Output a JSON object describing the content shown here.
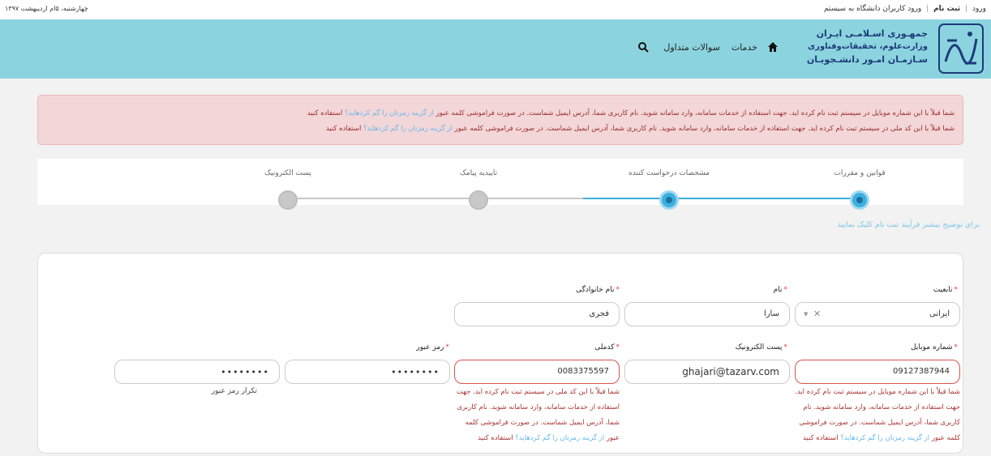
{
  "topbar": {
    "login": "ورود",
    "register": "ثبت نام",
    "welcome": "ورود کاربران دانشگاه به سیستم",
    "date": "چهارشنبه، ۵ام اردیبهشت ۱۳۹۷"
  },
  "header": {
    "org_line1": "جمهـوری اسـلامـی ایـران",
    "org_line2": "وزارت‌علوم، تحقیقات‌و‌فناوری",
    "org_line3": "سـازمـان امـور دانشـجویـان",
    "nav": {
      "services": "خدمات",
      "faq": "سوالات متداول"
    }
  },
  "alert": {
    "line1_text": "شما قبلاً با این شماره موبایل در سیستم ثبت نام کرده اید. جهت استفاده از خدمات سامانه، وارد سامانه شوید. نام کاربری شما، آدرس ایمیل شماست. در صورت فراموشی کلمه عبور ",
    "line1_link": "از گزینه رمزتان را گم کردهاید؟",
    "line1_end": " استفاده کنید",
    "line2_text": "شما قبلاً با این کد ملی در سیستم ثبت نام کرده اید. جهت استفاده از خدمات سامانه، وارد سامانه شوید. نام کاربری شما، آدرس ایمیل شماست. در صورت فراموشی کلمه عبور ",
    "line2_link": "از گزینه رمزتان را گم کردهاید؟",
    "line2_end": " استفاده کنید"
  },
  "steps": [
    {
      "label": "قوانین و مقررات",
      "active": true
    },
    {
      "label": "مشخصات درخواست کننده",
      "active": true
    },
    {
      "label": "تاییدیه پیامک",
      "active": false
    },
    {
      "label": "پست الکترونیک",
      "active": false
    }
  ],
  "explain": "برای توضیح بیشتر فرآیند ثبت نام کلیک نمایید",
  "form": {
    "nationality": {
      "label": "تابعیت",
      "value": "ایرانی"
    },
    "first_name": {
      "label": "نام",
      "value": "سارا"
    },
    "last_name": {
      "label": "نام خانوادگی",
      "value": "فجری"
    },
    "mobile": {
      "label": "شماره موبایل",
      "value": "09127387944"
    },
    "email": {
      "label": "پست الکترونیک",
      "value": "ghajari@tazarv.com"
    },
    "national_code": {
      "label": "کدملی",
      "value": "0083375597"
    },
    "password": {
      "label": "رمز عبور",
      "value": "••••••••"
    },
    "password_repeat": {
      "label": "تکرار رمز عبور",
      "value": "••••••••"
    },
    "mobile_error": {
      "text": "شما قبلاً با این شماره موبایل در سیستم ثبت نام کرده اید. جهت استفاده از خدمات سامانه، وارد سامانه شوید. نام کاربری شما، آدرس ایمیل شماست. در صورت فراموشی کلمه عبور ",
      "link": "از گزینه رمزتان را گم کردهاید؟",
      "end": " استفاده کنید"
    },
    "national_code_error": {
      "text": "شما قبلاً با این کد ملی در سیستم ثبت نام کرده اید. جهت استفاده از خدمات سامانه، وارد سامانه شوید. نام کاربری شما، آدرس ایمیل شماست. در صورت فراموشی کلمه عبور ",
      "link": "از گزینه رمزتان را گم کردهاید؟",
      "end": " استفاده کنید"
    }
  },
  "colors": {
    "header_bg": "#8bd4df",
    "accent": "#3bb0e0",
    "error": "#d9534f",
    "alert_bg": "#f3d6d8"
  }
}
